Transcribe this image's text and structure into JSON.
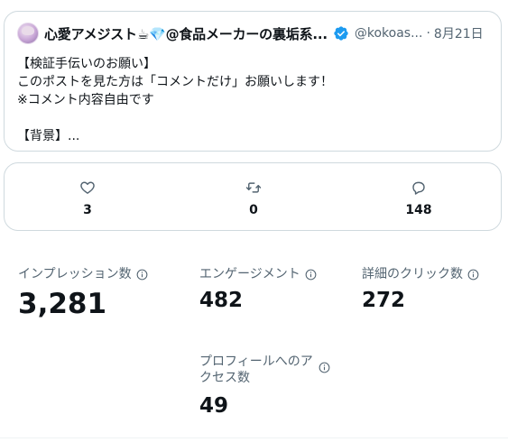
{
  "tweet": {
    "author_name": "心愛アメジスト☕💎@食品メーカーの裏垢系...",
    "handle": "@kokoas...",
    "separator": "·",
    "date": "8月21日",
    "lines": [
      "【検証手伝いのお願い】",
      "このポストを見た方は「コメントだけ」お願いします！",
      "※コメント内容自由です",
      "",
      "【背景】..."
    ]
  },
  "actions": {
    "like_count": "3",
    "repost_count": "0",
    "reply_count": "148"
  },
  "metrics": {
    "impressions": {
      "label": "インプレッション数",
      "value": "3,281"
    },
    "engagements": {
      "label": "エンゲージメント",
      "value": "482"
    },
    "detail_clicks": {
      "label": "詳細のクリック数",
      "value": "272"
    },
    "profile_visits": {
      "label_line1": "プロフィールへのア",
      "label_line2": "クセス数",
      "value": "49"
    }
  },
  "colors": {
    "text": "#0f1419",
    "secondary": "#536471",
    "border": "#cfd9de",
    "verified": "#1d9bf0"
  },
  "icons": [
    "avatar",
    "verified-badge-icon",
    "heart-icon",
    "repost-icon",
    "reply-icon",
    "info-icon"
  ]
}
